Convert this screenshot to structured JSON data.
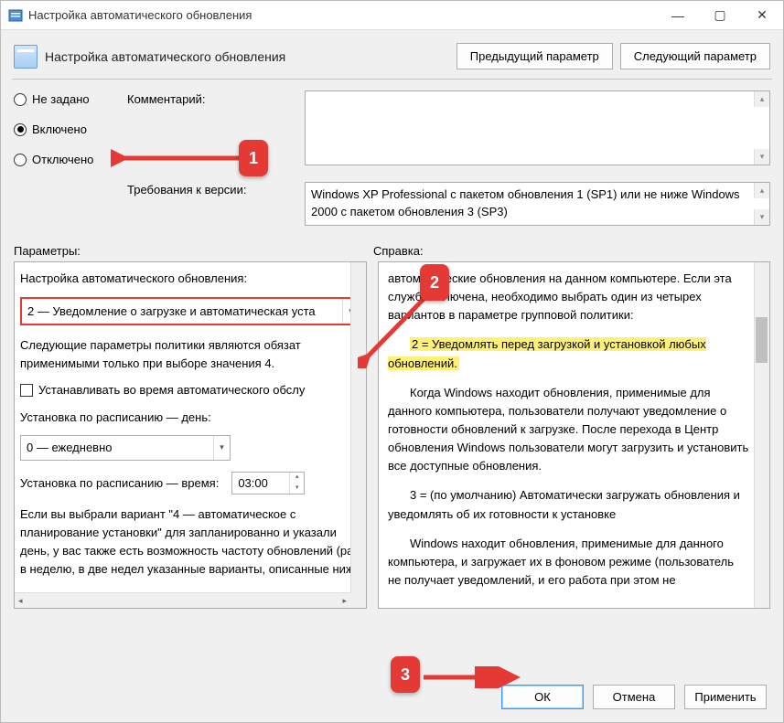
{
  "window": {
    "title": "Настройка автоматического обновления"
  },
  "header": {
    "policy_title": "Настройка автоматического обновления",
    "prev_btn": "Предыдущий параметр",
    "next_btn": "Следующий параметр"
  },
  "radios": {
    "not_configured": "Не задано",
    "enabled": "Включено",
    "disabled": "Отключено",
    "selected": "enabled"
  },
  "labels": {
    "comment": "Комментарий:",
    "requirements": "Требования к версии:",
    "parameters": "Параметры:",
    "help": "Справка:"
  },
  "requirements": "Windows XP Professional с пакетом обновления 1 (SP1) или не ниже Windows 2000 с пакетом обновления 3 (SP3)",
  "params": {
    "title": "Настройка автоматического обновления:",
    "mode_select": "2 — Уведомление о загрузке и автоматическая уста",
    "note1": "Следующие параметры политики являются обязат применимыми только при выборе значения 4.",
    "checkbox": "Устанавливать во время автоматического обслу",
    "sched_day_label": "Установка по расписанию — день:",
    "sched_day_value": "0 — ежедневно",
    "sched_time_label": "Установка по расписанию — время:",
    "sched_time_value": "03:00",
    "note2": "Если вы выбрали вариант \"4 — автоматическое с планирование установки\" для запланированно и указали день, у вас также есть возможность частоту обновлений (раз в неделю, в две недел указанные варианты, описанные ниже"
  },
  "help": {
    "p1": "автоматические обновления на данном компьютере. Если эта служба включена, необходимо выбрать один из четырех вариантов в параметре групповой политики:",
    "highlight": "2 = Уведомлять перед загрузкой и установкой любых обновлений.",
    "p2": "Когда Windows находит обновления, применимые для данного компьютера, пользователи получают уведомление о готовности обновлений к загрузке. После перехода в Центр обновления Windows пользователи могут загрузить и установить все доступные обновления.",
    "p3": "3 = (по умолчанию) Автоматически загружать обновления и уведомлять об их готовности к установке",
    "p4": "Windows находит обновления, применимые для данного компьютера, и загружает их в фоновом режиме (пользователь не получает уведомлений, и его работа при этом не"
  },
  "footer": {
    "ok": "ОК",
    "cancel": "Отмена",
    "apply": "Применить"
  },
  "badges": {
    "b1": "1",
    "b2": "2",
    "b3": "3"
  }
}
